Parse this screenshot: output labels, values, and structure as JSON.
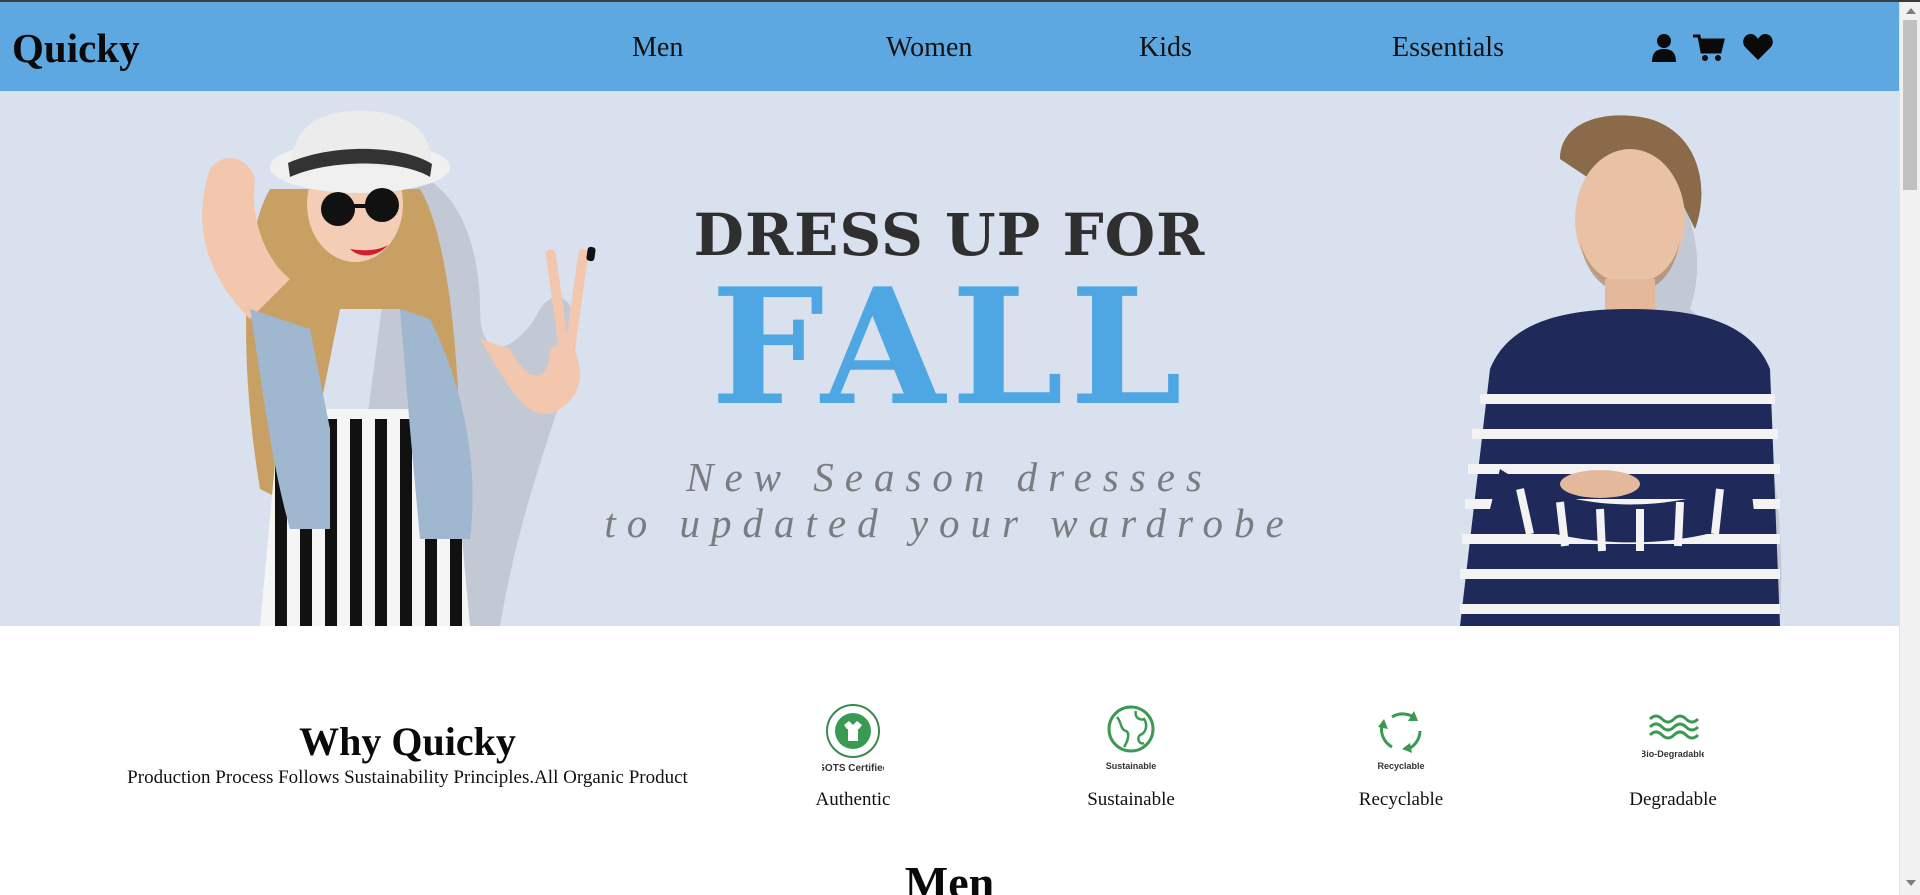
{
  "navbar": {
    "brand": "Quicky",
    "links": [
      "Men",
      "Women",
      "Kids",
      "Essentials"
    ],
    "icons": [
      "user-icon",
      "cart-icon",
      "heart-icon"
    ],
    "background": "#5ea8e1"
  },
  "hero": {
    "headline": "DRESS UP FOR",
    "highlight": "FALL",
    "subline_1": "New Season dresses",
    "subline_2": "to updated your wardrobe",
    "background": "#dae1ee",
    "highlight_color": "#4ea6e3"
  },
  "why": {
    "title": "Why Quicky",
    "description": "Production Process Follows Sustainability Principles.All Organic Product",
    "features": [
      {
        "badge_text": "GOTS Certified",
        "label": "Authentic",
        "icon": "gots-certified-icon"
      },
      {
        "badge_text": "Sustainable",
        "label": "Sustainable",
        "icon": "globe-icon"
      },
      {
        "badge_text": "Recyclable",
        "label": "Recyclable",
        "icon": "recycle-icon"
      },
      {
        "badge_text": "Bio-Degradable",
        "label": "Degradable",
        "icon": "waves-icon"
      }
    ]
  },
  "next_section": {
    "title": "Men"
  }
}
